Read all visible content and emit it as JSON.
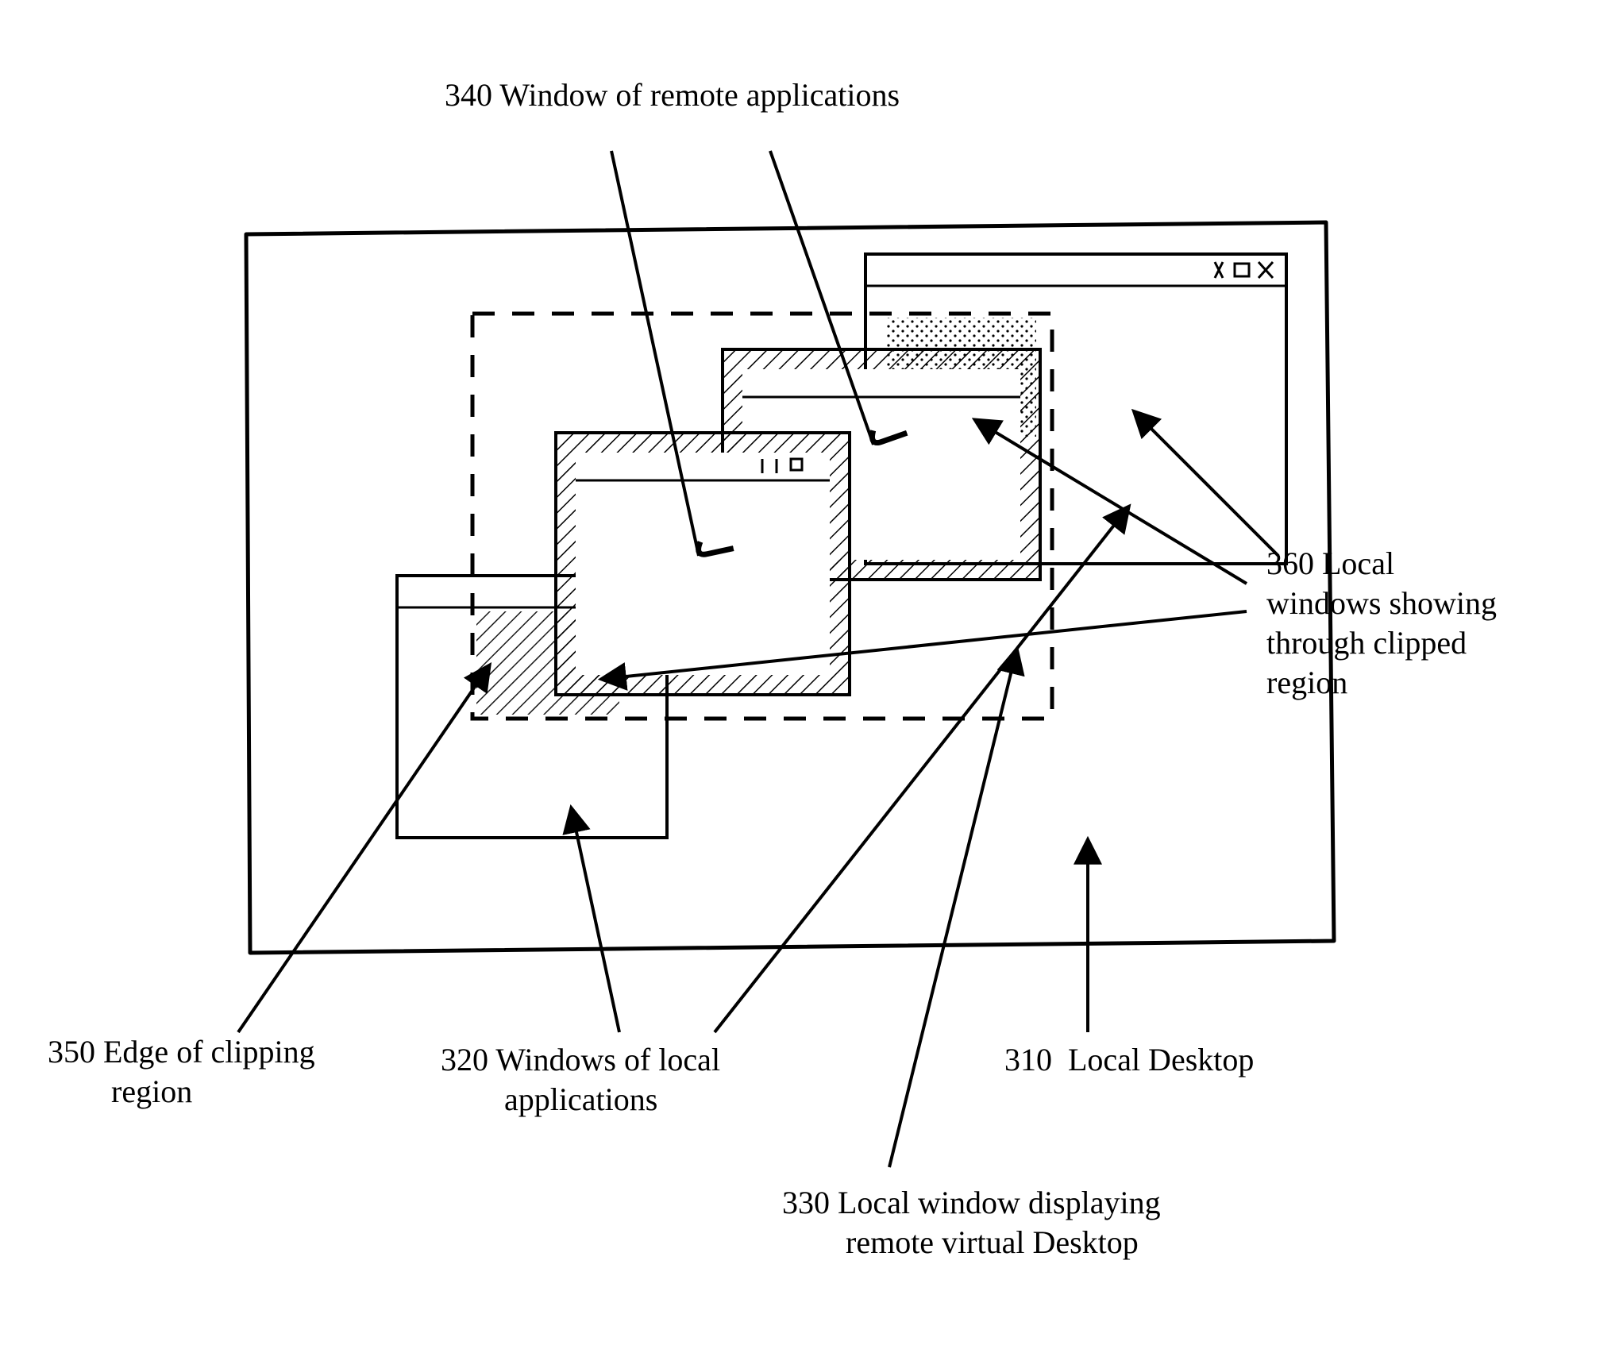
{
  "labels": {
    "l340": "340 Window of remote applications",
    "l360": "360 Local\nwindows showing\nthrough clipped\nregion",
    "l350": "350 Edge of clipping\n        region",
    "l320": "320 Windows of local\n        applications",
    "l310": "310  Local Desktop",
    "l330": "330 Local window displaying\n        remote virtual Desktop"
  }
}
